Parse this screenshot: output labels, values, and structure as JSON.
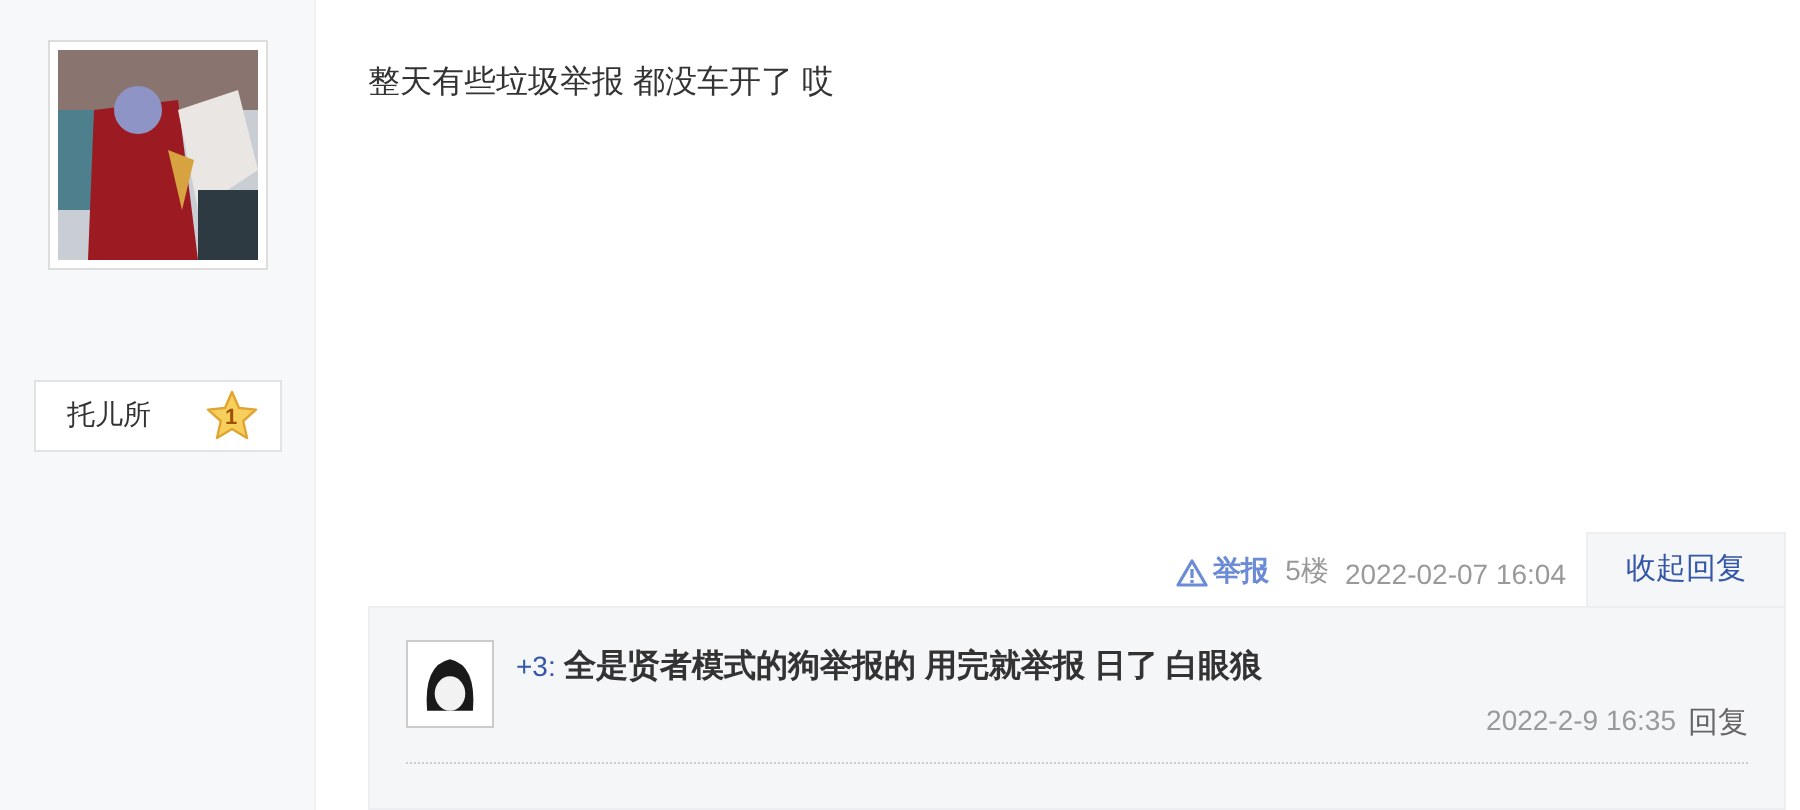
{
  "author": {
    "badge": {
      "title": "托儿所",
      "level": "1"
    }
  },
  "post": {
    "content": "整天有些垃圾举报 都没车开了 哎",
    "report": "举报",
    "floor": "5楼",
    "time": "2022-02-07 16:04",
    "toggle": "收起回复"
  },
  "replies": [
    {
      "score": "+3:",
      "content": "全是贤者模式的狗举报的 用完就举报 日了 白眼狼",
      "time": "2022-2-9 16:35",
      "reply": "回复"
    }
  ]
}
